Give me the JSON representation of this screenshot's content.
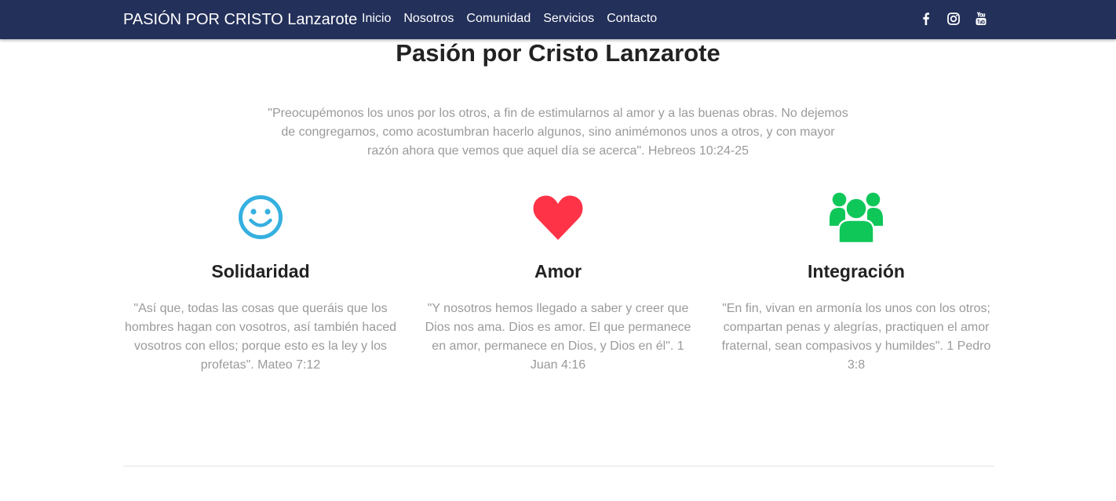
{
  "navbar": {
    "brand": "PASIÓN POR CRISTO Lanzarote",
    "links": [
      "Inicio",
      "Nosotros",
      "Comunidad",
      "Servicios",
      "Contacto"
    ],
    "social": [
      "facebook-icon",
      "instagram-icon",
      "youtube-icon"
    ],
    "background_color": "#23305a"
  },
  "main": {
    "title": "Pasión por Cristo Lanzarote",
    "quote": "\"Preocupémonos los unos por los otros, a fin de estimularnos al amor y a las buenas obras. No dejemos de congregarnos, como acostumbran hacerlo algunos, sino animémonos unos a otros, y con mayor razón ahora que vemos que aquel día se acerca\". Hebreos 10:24-25"
  },
  "features": [
    {
      "icon": "smiley-icon",
      "icon_color": "#35b0e0",
      "title": "Solidaridad",
      "text": "\"Así que, todas las cosas que queráis que los hombres hagan con vosotros, así también haced vosotros con ellos; porque esto es la ley y los profetas\". Mateo 7:12"
    },
    {
      "icon": "heart-icon",
      "icon_color": "#ff3347",
      "title": "Amor",
      "text": "\"Y nosotros hemos llegado a saber y creer que Dios nos ama. Dios es amor. El que permanece en amor, permanece en Dios, y Dios en él\". 1 Juan 4:16"
    },
    {
      "icon": "users-group-icon",
      "icon_color": "#0fc759",
      "title": "Integración",
      "text": "\"En fin, vivan en armonía los unos con los otros; compartan penas y alegrías, practiquen el amor fraternal, sean compasivos y humildes\". 1 Pedro 3:8"
    }
  ]
}
